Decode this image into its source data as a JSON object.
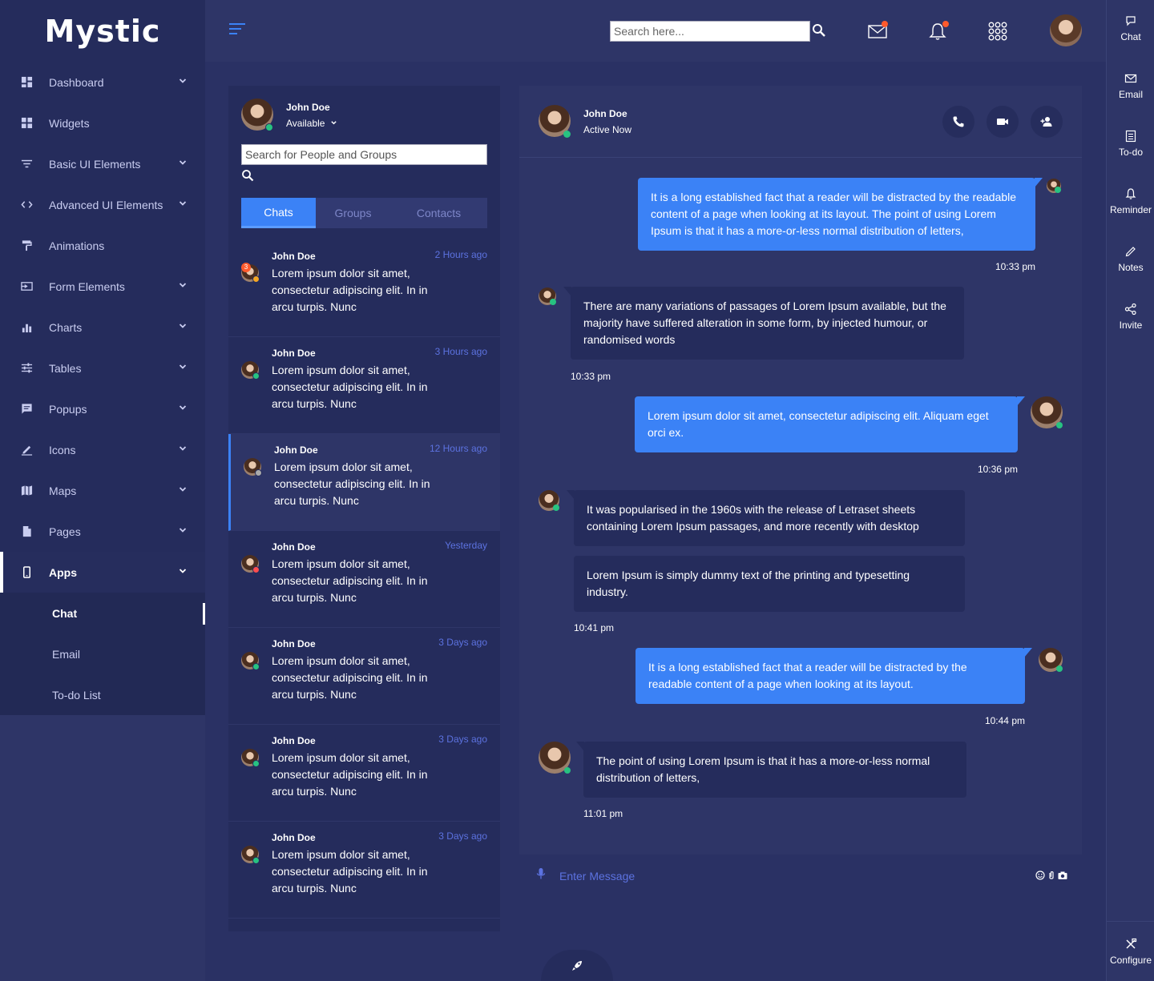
{
  "app": {
    "brand": "Mystic"
  },
  "colors": {
    "accent": "#3b82f6",
    "online": "#27c281",
    "notify": "#ff5a2c",
    "time": "#5c72e0"
  },
  "sidebar": {
    "items": [
      {
        "label": "Dashboard",
        "icon": "dashboard-icon",
        "chevron": true
      },
      {
        "label": "Widgets",
        "icon": "widgets-icon",
        "chevron": false
      },
      {
        "label": "Basic UI Elements",
        "icon": "filter-icon",
        "chevron": true
      },
      {
        "label": "Advanced UI Elements",
        "icon": "code-icon",
        "chevron": true
      },
      {
        "label": "Animations",
        "icon": "paint-roller-icon",
        "chevron": false
      },
      {
        "label": "Form Elements",
        "icon": "input-icon",
        "chevron": true
      },
      {
        "label": "Charts",
        "icon": "bar-chart-icon",
        "chevron": true
      },
      {
        "label": "Tables",
        "icon": "sliders-icon",
        "chevron": true
      },
      {
        "label": "Popups",
        "icon": "message-icon",
        "chevron": true
      },
      {
        "label": "Icons",
        "icon": "edit-icon",
        "chevron": true
      },
      {
        "label": "Maps",
        "icon": "map-icon",
        "chevron": true
      },
      {
        "label": "Pages",
        "icon": "page-icon",
        "chevron": true
      },
      {
        "label": "Apps",
        "icon": "mobile-icon",
        "chevron": true
      }
    ],
    "apps_sub": [
      "Chat",
      "Email",
      "To-do List"
    ]
  },
  "header": {
    "search_placeholder": "Search here..."
  },
  "rail": {
    "items": [
      "Chat",
      "Email",
      "To-do",
      "Reminder",
      "Notes",
      "Invite"
    ],
    "configure": "Configure"
  },
  "chatlist": {
    "me_name": "John Doe",
    "me_status": "Available",
    "search_placeholder": "Search for People and Groups",
    "tabs": [
      "Chats",
      "Groups",
      "Contacts"
    ],
    "conversations": [
      {
        "name": "John Doe",
        "time": "2 Hours ago",
        "text": "Lorem ipsum dolor sit amet, consectetur adipiscing elit. In in arcu turpis. Nunc",
        "badge": "3"
      },
      {
        "name": "John Doe",
        "time": "3 Hours ago",
        "text": "Lorem ipsum dolor sit amet, consectetur adipiscing elit. In in arcu turpis. Nunc"
      },
      {
        "name": "John Doe",
        "time": "12 Hours ago",
        "text": "Lorem ipsum dolor sit amet, consectetur adipiscing elit. In in arcu turpis. Nunc"
      },
      {
        "name": "John Doe",
        "time": "Yesterday",
        "text": "Lorem ipsum dolor sit amet, consectetur adipiscing elit. In in arcu turpis. Nunc"
      },
      {
        "name": "John Doe",
        "time": "3 Days ago",
        "text": "Lorem ipsum dolor sit amet, consectetur adipiscing elit. In in arcu turpis. Nunc"
      },
      {
        "name": "John Doe",
        "time": "3 Days ago",
        "text": "Lorem ipsum dolor sit amet, consectetur adipiscing elit. In in arcu turpis. Nunc"
      },
      {
        "name": "John Doe",
        "time": "3 Days ago",
        "text": "Lorem ipsum dolor sit amet, consectetur adipiscing elit. In in arcu turpis. Nunc"
      }
    ]
  },
  "chat": {
    "contact_name": "John Doe",
    "contact_status": "Active Now",
    "messages": [
      {
        "dir": "out",
        "text": "It is a long established fact that a reader will be distracted by the readable content of a page when looking at its layout. The point of using Lorem Ipsum is that it has a more-or-less normal distribution of letters,",
        "time": "10:33 pm"
      },
      {
        "dir": "in",
        "text": "There are many variations of passages of Lorem Ipsum available, but the majority have suffered alteration in some form, by injected humour, or randomised words",
        "time": "10:33 pm"
      },
      {
        "dir": "out",
        "text": "Lorem ipsum dolor sit amet, consectetur adipiscing elit. Aliquam eget orci ex.",
        "time": "10:36 pm"
      },
      {
        "dir": "in",
        "text": "It was popularised in the 1960s with the release of Letraset sheets containing Lorem Ipsum passages, and more recently with desktop",
        "time": ""
      },
      {
        "dir": "in",
        "text": "Lorem Ipsum is simply dummy text of the printing and typesetting industry.",
        "time": "10:41 pm"
      },
      {
        "dir": "out",
        "text": "It is a long established fact that a reader will be distracted by the readable content of a page when looking at its layout.",
        "time": "10:44 pm"
      },
      {
        "dir": "in",
        "text": "The point of using Lorem Ipsum is that it has a more-or-less normal distribution of letters,",
        "time": "11:01 pm"
      }
    ],
    "input_placeholder": "Enter Message"
  }
}
